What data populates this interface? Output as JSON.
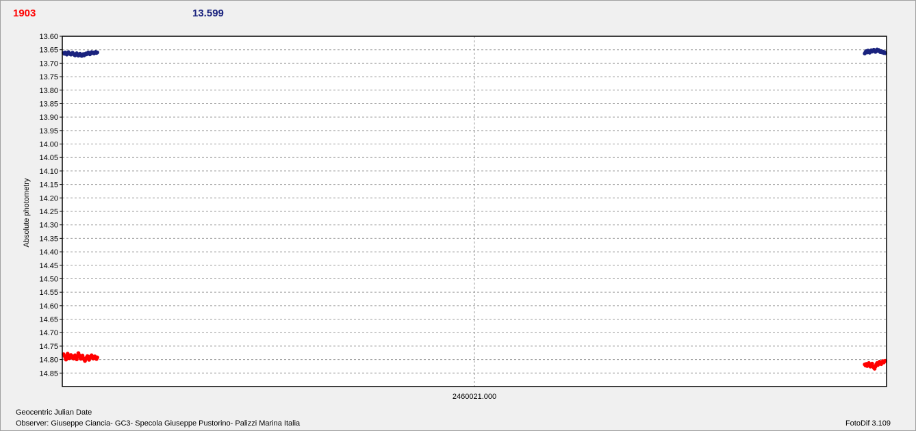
{
  "header": {
    "left_value": "1903",
    "right_value": "13.599"
  },
  "footer": {
    "xlabel": "Geocentric Julian Date",
    "observer": "Observer: Giuseppe Ciancia- GC3- Specola Giuseppe Pustorino- Palizzi Marina Italia",
    "version": "FotoDif 3.109"
  },
  "chart_data": {
    "type": "scatter",
    "title": "",
    "xlabel": "Geocentric Julian Date",
    "ylabel": "Absolute photometry",
    "x_tick_labels": [
      "2460021.000"
    ],
    "xlim": [
      -0.5,
      0.5
    ],
    "ylim": [
      13.6,
      14.9
    ],
    "y_inverted": true,
    "y_ticks": [
      13.6,
      13.65,
      13.7,
      13.75,
      13.8,
      13.85,
      13.9,
      13.95,
      14.0,
      14.05,
      14.1,
      14.15,
      14.2,
      14.25,
      14.3,
      14.35,
      14.4,
      14.45,
      14.5,
      14.55,
      14.6,
      14.65,
      14.7,
      14.75,
      14.8,
      14.85
    ],
    "grid": true,
    "series": [
      {
        "color": "#1a237e",
        "x": [
          -0.4985,
          -0.4975,
          -0.4965,
          -0.4955,
          -0.4945,
          -0.4935,
          -0.4925,
          -0.4915,
          -0.4905,
          -0.4895,
          -0.4885,
          -0.4875,
          -0.4865,
          -0.4855,
          -0.4845,
          -0.4835,
          -0.4825,
          -0.4815,
          -0.4805,
          -0.4795,
          -0.4785,
          -0.4775,
          -0.4765,
          -0.4755,
          -0.4745,
          -0.4735,
          -0.4725,
          -0.4715,
          -0.4705,
          -0.4695,
          -0.4685,
          -0.4675,
          -0.4665,
          -0.4655,
          -0.4645,
          -0.4635,
          -0.4625,
          -0.4615,
          -0.4605,
          -0.4595,
          -0.4585,
          -0.4575,
          0.4735,
          0.4745,
          0.4755,
          0.4765,
          0.4775,
          0.4785,
          0.4795,
          0.4805,
          0.4815,
          0.4825,
          0.4835,
          0.4845,
          0.4855,
          0.4865,
          0.4875,
          0.4885,
          0.4895,
          0.4905,
          0.4915,
          0.4925,
          0.4935,
          0.4945,
          0.4955,
          0.4965,
          0.4975,
          0.4985
        ],
        "y": [
          13.662,
          13.665,
          13.66,
          13.664,
          13.668,
          13.662,
          13.659,
          13.663,
          13.666,
          13.668,
          13.664,
          13.661,
          13.665,
          13.669,
          13.671,
          13.667,
          13.663,
          13.668,
          13.672,
          13.669,
          13.665,
          13.67,
          13.673,
          13.668,
          13.666,
          13.671,
          13.668,
          13.664,
          13.667,
          13.663,
          13.66,
          13.664,
          13.667,
          13.663,
          13.659,
          13.662,
          13.66,
          13.664,
          13.661,
          13.658,
          13.662,
          13.66,
          13.664,
          13.658,
          13.655,
          13.66,
          13.653,
          13.657,
          13.661,
          13.655,
          13.652,
          13.657,
          13.654,
          13.65,
          13.655,
          13.658,
          13.653,
          13.649,
          13.654,
          13.651,
          13.656,
          13.659,
          13.655,
          13.66,
          13.657,
          13.662,
          13.659,
          13.663
        ]
      },
      {
        "color": "#ff0000",
        "x": [
          -0.4985,
          -0.4975,
          -0.4965,
          -0.4955,
          -0.4945,
          -0.4935,
          -0.4925,
          -0.4915,
          -0.4905,
          -0.4895,
          -0.4885,
          -0.4875,
          -0.4865,
          -0.4855,
          -0.4845,
          -0.4835,
          -0.4825,
          -0.4815,
          -0.4805,
          -0.4795,
          -0.4785,
          -0.4775,
          -0.4765,
          -0.4755,
          -0.4745,
          -0.4735,
          -0.4725,
          -0.4715,
          -0.4705,
          -0.4695,
          -0.4685,
          -0.4675,
          -0.4665,
          -0.4655,
          -0.4645,
          -0.4635,
          -0.4625,
          -0.4615,
          -0.4605,
          -0.4595,
          -0.4585,
          -0.4575,
          0.4735,
          0.4745,
          0.4755,
          0.4765,
          0.4775,
          0.4785,
          0.4795,
          0.4805,
          0.4815,
          0.4825,
          0.4835,
          0.4845,
          0.4855,
          0.4865,
          0.4875,
          0.4885,
          0.4895,
          0.4905,
          0.4915,
          0.4925,
          0.4935,
          0.4945,
          0.4955,
          0.4965,
          0.4975,
          0.4985
        ],
        "y": [
          14.78,
          14.785,
          14.792,
          14.8,
          14.788,
          14.778,
          14.786,
          14.795,
          14.79,
          14.783,
          14.792,
          14.788,
          14.796,
          14.79,
          14.784,
          14.793,
          14.799,
          14.787,
          14.776,
          14.783,
          14.792,
          14.797,
          14.79,
          14.785,
          14.794,
          14.8,
          14.805,
          14.798,
          14.792,
          14.787,
          14.795,
          14.801,
          14.794,
          14.788,
          14.784,
          14.79,
          14.796,
          14.792,
          14.788,
          14.794,
          14.798,
          14.792,
          14.818,
          14.822,
          14.816,
          14.824,
          14.819,
          14.813,
          14.82,
          14.826,
          14.821,
          14.815,
          14.824,
          14.83,
          14.834,
          14.826,
          14.818,
          14.813,
          14.82,
          14.814,
          14.808,
          14.812,
          14.817,
          14.81,
          14.806,
          14.811,
          14.807,
          14.805
        ]
      }
    ]
  }
}
